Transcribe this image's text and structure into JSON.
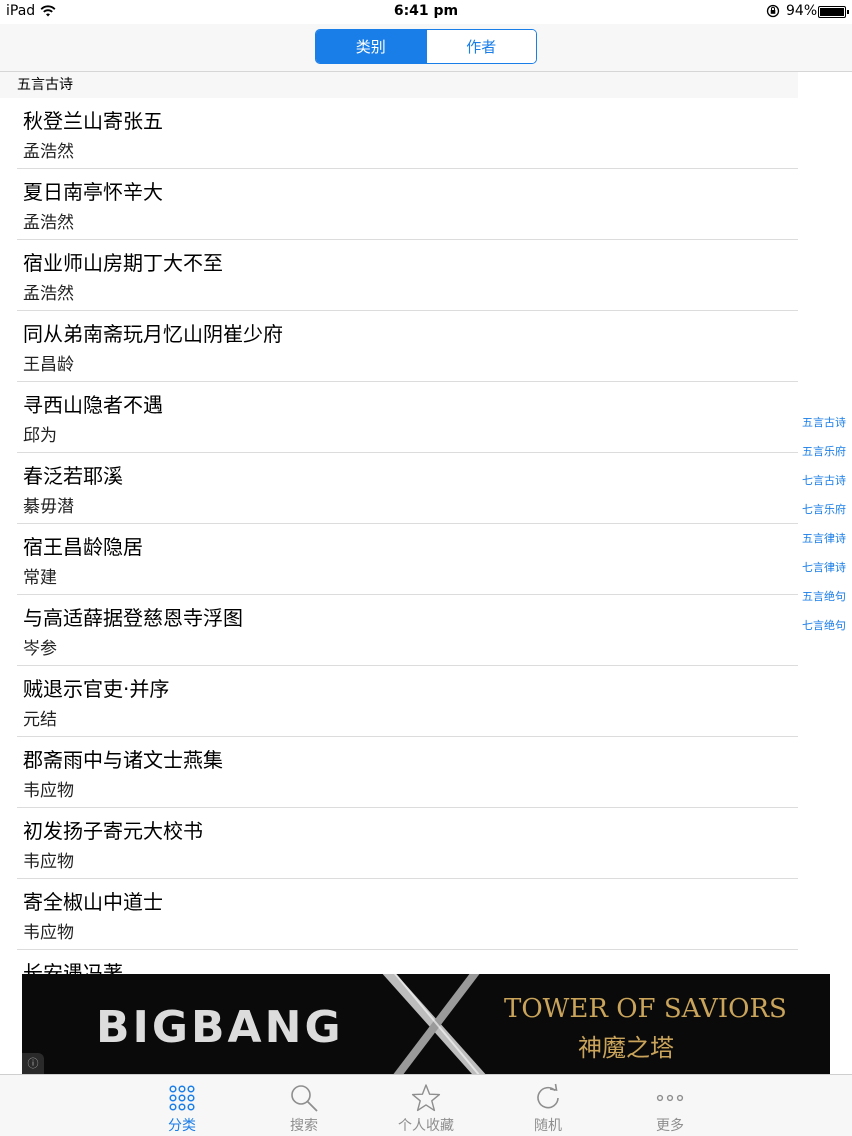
{
  "status_bar": {
    "device": "iPad",
    "time": "6:41 pm",
    "battery": "94%",
    "battery_level": 0.94
  },
  "segmented_control": {
    "segments": [
      {
        "label": "类别",
        "selected": true
      },
      {
        "label": "作者",
        "selected": false
      }
    ]
  },
  "section_header": "五言古诗",
  "poems": [
    {
      "title": "秋登兰山寄张五",
      "author": "孟浩然"
    },
    {
      "title": "夏日南亭怀辛大",
      "author": "孟浩然"
    },
    {
      "title": "宿业师山房期丁大不至",
      "author": "孟浩然"
    },
    {
      "title": "同从弟南斋玩月忆山阴崔少府",
      "author": "王昌龄"
    },
    {
      "title": "寻西山隐者不遇",
      "author": "邱为"
    },
    {
      "title": "春泛若耶溪",
      "author": "綦毋潜"
    },
    {
      "title": "宿王昌龄隐居",
      "author": "常建"
    },
    {
      "title": "与高适薛据登慈恩寺浮图",
      "author": "岑参"
    },
    {
      "title": "贼退示官吏·并序",
      "author": "元结"
    },
    {
      "title": "郡斋雨中与诸文士燕集",
      "author": "韦应物"
    },
    {
      "title": "初发扬子寄元大校书",
      "author": "韦应物"
    },
    {
      "title": "寄全椒山中道士",
      "author": "韦应物"
    },
    {
      "title": "长安遇冯著",
      "author": ""
    }
  ],
  "section_index": [
    "五言古诗",
    "五言乐府",
    "七言古诗",
    "七言乐府",
    "五言律诗",
    "七言律诗",
    "五言绝句",
    "七言绝句"
  ],
  "ad": {
    "left_text": "BIGBANG",
    "right_text_1": "TOWER OF SAVIORS",
    "right_text_2": "神魔之塔",
    "info_icon": "ⓘ"
  },
  "tab_bar": {
    "tabs": [
      {
        "label": "分类",
        "icon": "grid-icon",
        "active": true
      },
      {
        "label": "搜索",
        "icon": "search-icon",
        "active": false
      },
      {
        "label": "个人收藏",
        "icon": "star-icon",
        "active": false
      },
      {
        "label": "随机",
        "icon": "refresh-icon",
        "active": false
      },
      {
        "label": "更多",
        "icon": "more-icon",
        "active": false
      }
    ]
  },
  "colors": {
    "accent": "#1a7ee8",
    "inactive": "#8e8e8e",
    "ad_gold": "#c9a45a"
  }
}
